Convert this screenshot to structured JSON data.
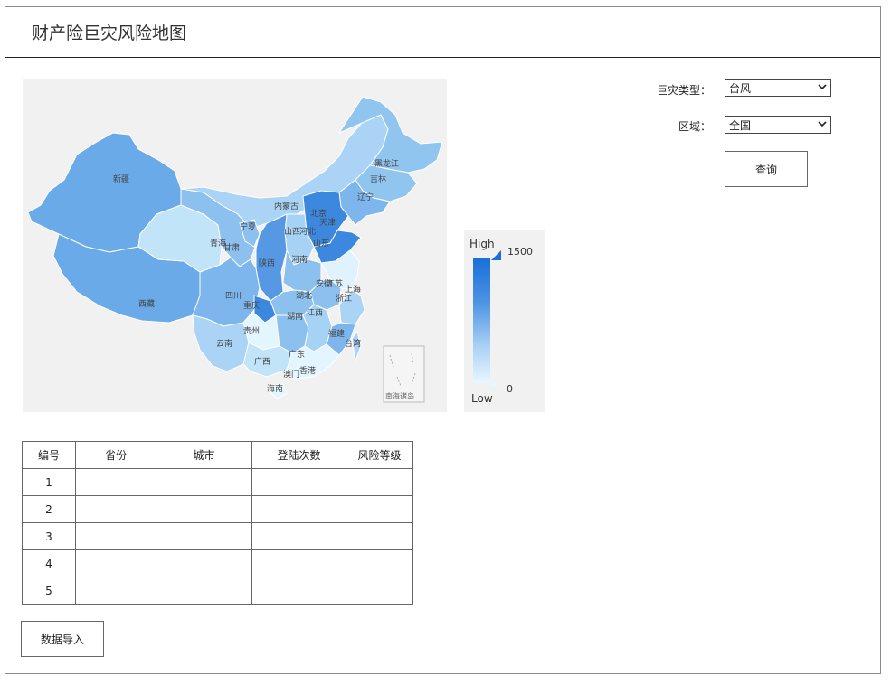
{
  "page": {
    "title": "财产险巨灾风险地图"
  },
  "filters": {
    "disaster_type_label": "巨灾类型：",
    "disaster_type_value": "台风",
    "region_label": "区域：",
    "region_value": "全国",
    "query_button": "查询"
  },
  "legend": {
    "high": "High",
    "low": "Low",
    "max": "1500",
    "min": "0",
    "high_color": "#1a6fd8",
    "low_color": "#e8f7ff"
  },
  "map": {
    "inset_label": "南海诸岛",
    "labels": {
      "xinjiang": "新疆",
      "xizang": "西藏",
      "qinghai": "青海",
      "gansu": "甘肃",
      "ningxia": "宁夏",
      "neimenggu": "内蒙古",
      "heilongjiang": "黑龙江",
      "jilin": "吉林",
      "liaoning": "辽宁",
      "beijing": "北京",
      "tianjin": "天津",
      "hebei": "河北",
      "shanxi": "山西",
      "shandong": "山东",
      "henan": "河南",
      "shaanxi": "陕西",
      "sichuan": "四川",
      "chongqing": "重庆",
      "hubei": "湖北",
      "anhui": "安徽",
      "jiangsu": "江苏",
      "shanghai": "上海",
      "zhejiang": "浙江",
      "hunan": "湖南",
      "jiangxi": "江西",
      "fujian": "福建",
      "taiwan": "台湾",
      "guizhou": "贵州",
      "yunnan": "云南",
      "guangxi": "广西",
      "guangdong": "广东",
      "xianggang": "香港",
      "aomen": "澳门",
      "hainan": "海南"
    }
  },
  "table": {
    "headers": [
      "编号",
      "省份",
      "城市",
      "登陆次数",
      "风险等级"
    ],
    "rows": [
      [
        "1",
        "",
        "",
        "",
        ""
      ],
      [
        "2",
        "",
        "",
        "",
        ""
      ],
      [
        "3",
        "",
        "",
        "",
        ""
      ],
      [
        "4",
        "",
        "",
        "",
        ""
      ],
      [
        "5",
        "",
        "",
        "",
        ""
      ]
    ]
  },
  "import_button": "数据导入"
}
